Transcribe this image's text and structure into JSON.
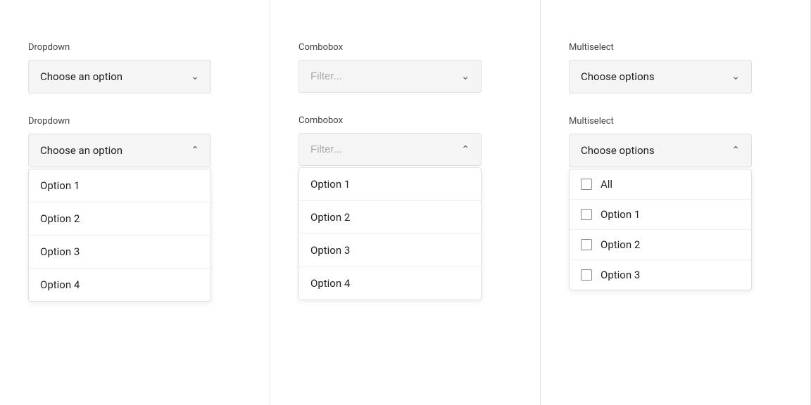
{
  "columns": [
    {
      "id": "dropdown",
      "sections": [
        {
          "id": "dropdown-closed",
          "label": "Dropdown",
          "type": "dropdown",
          "placeholder": "Choose an option",
          "open": false,
          "chevron": "down",
          "options": []
        },
        {
          "id": "dropdown-open",
          "label": "Dropdown",
          "type": "dropdown",
          "placeholder": "Choose an option",
          "open": true,
          "chevron": "up",
          "options": [
            "Option 1",
            "Option 2",
            "Option 3",
            "Option 4"
          ]
        }
      ]
    },
    {
      "id": "combobox",
      "sections": [
        {
          "id": "combobox-closed",
          "label": "Combobox",
          "type": "combobox",
          "placeholder": "Filter...",
          "open": false,
          "chevron": "down",
          "options": []
        },
        {
          "id": "combobox-open",
          "label": "Combobox",
          "type": "combobox",
          "placeholder": "Filter...",
          "open": true,
          "chevron": "up",
          "options": [
            "Option 1",
            "Option 2",
            "Option 3",
            "Option 4"
          ]
        }
      ]
    },
    {
      "id": "multiselect",
      "sections": [
        {
          "id": "multiselect-closed",
          "label": "Multiselect",
          "type": "multiselect",
          "placeholder": "Choose options",
          "open": false,
          "chevron": "down",
          "options": []
        },
        {
          "id": "multiselect-open",
          "label": "Multiselect",
          "type": "multiselect",
          "placeholder": "Choose options",
          "open": true,
          "chevron": "up",
          "options": [
            "All",
            "Option 1",
            "Option 2",
            "Option 3"
          ]
        }
      ]
    }
  ],
  "chevrons": {
    "down": "&#8964;",
    "up": "&#8963;"
  }
}
